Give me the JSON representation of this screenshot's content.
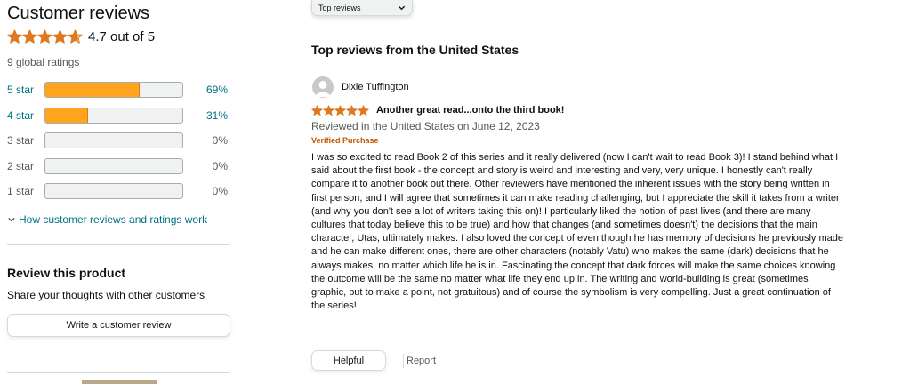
{
  "customer_reviews": {
    "title": "Customer reviews",
    "average_rating": 4.7,
    "rating_text": "4.7 out of 5",
    "global_ratings": "9 global ratings",
    "histogram": [
      {
        "label": "5 star",
        "percent": 69,
        "percent_text": "69%",
        "linked": true
      },
      {
        "label": "4 star",
        "percent": 31,
        "percent_text": "31%",
        "linked": true
      },
      {
        "label": "3 star",
        "percent": 0,
        "percent_text": "0%",
        "linked": false
      },
      {
        "label": "2 star",
        "percent": 0,
        "percent_text": "0%",
        "linked": false
      },
      {
        "label": "1 star",
        "percent": 0,
        "percent_text": "0%",
        "linked": false
      }
    ],
    "how_link": "How customer reviews and ratings work"
  },
  "review_product": {
    "heading": "Review this product",
    "subtext": "Share your thoughts with other customers",
    "button": "Write a customer review"
  },
  "sort": {
    "selected": "Top reviews"
  },
  "top_reviews": {
    "heading": "Top reviews from the United States",
    "review": {
      "reviewer": "Dixie Tuffington",
      "stars": 5,
      "title": "Another great read...onto the third book!",
      "date": "Reviewed in the United States on June 12, 2023",
      "verified": "Verified Purchase",
      "body": "I was so excited to read Book 2 of this series and it really delivered (now I can't wait to read Book 3)! I stand behind what I said about the first book - the concept and story is weird and interesting and very, very unique. I honestly can't really compare it to another book out there. Other reviewers have mentioned the inherent issues with the story being written in first person, and I will agree that sometimes it can make reading challenging, but I appreciate the skill it takes from a writer (and why you don't see a lot of writers taking this on)! I particularly liked the notion of past lives (and there are many cultures that today believe this to be true) and how that changes (and sometimes doesn't) the decisions that the main character, Utas, ultimately makes. I also loved the concept of even though he has memory of decisions he previously made and he can make different ones, there are other characters (notably Vatu) who makes the same (dark) decisions that he always makes, no matter which life he is in. Fascinating the concept that dark forces will make the same choices knowing the outcome will be the same no matter what life they end up in. The writing and world-building is great (sometimes graphic, but to make a point, not gratuitous) and of course the symbolism is very compelling. Just a great continuation of the series!",
      "helpful_label": "Helpful",
      "report_label": "Report"
    }
  },
  "colors": {
    "star": "#de7921",
    "bar_fill": "#ffa41c",
    "link": "#007185",
    "verified": "#c45500"
  }
}
